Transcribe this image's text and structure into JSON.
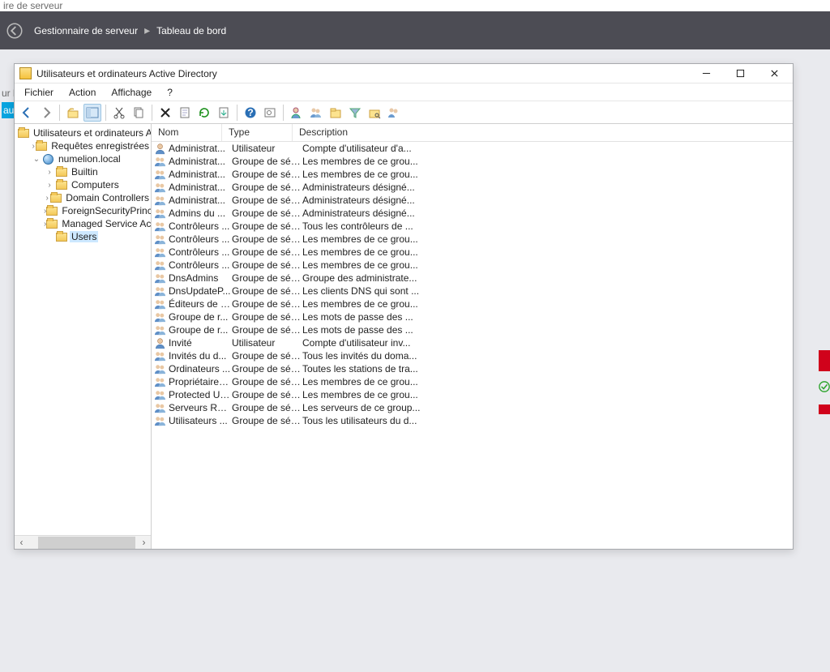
{
  "background": {
    "titlebar_fragment": "ire de serveur",
    "header_title": "Gestionnaire de serveur",
    "header_page": "Tableau de bord",
    "left_txt": "ur l",
    "blue_txt": "au c"
  },
  "window": {
    "title": "Utilisateurs et ordinateurs Active Directory",
    "menu": [
      "Fichier",
      "Action",
      "Affichage",
      "?"
    ]
  },
  "tree": [
    {
      "depth": 0,
      "exp": "",
      "icon": "folder",
      "label": "Utilisateurs et ordinateurs Active"
    },
    {
      "depth": 1,
      "exp": "›",
      "icon": "folder",
      "label": "Requêtes enregistrées"
    },
    {
      "depth": 1,
      "exp": "⌄",
      "icon": "globe",
      "label": "numelion.local"
    },
    {
      "depth": 2,
      "exp": "›",
      "icon": "folder",
      "label": "Builtin"
    },
    {
      "depth": 2,
      "exp": "›",
      "icon": "folder",
      "label": "Computers"
    },
    {
      "depth": 2,
      "exp": "›",
      "icon": "folder",
      "label": "Domain Controllers"
    },
    {
      "depth": 2,
      "exp": "›",
      "icon": "folder",
      "label": "ForeignSecurityPrincipals"
    },
    {
      "depth": 2,
      "exp": "›",
      "icon": "folder",
      "label": "Managed Service Account"
    },
    {
      "depth": 2,
      "exp": "",
      "icon": "folder",
      "label": "Users",
      "sel": true
    }
  ],
  "columns": {
    "name": "Nom",
    "type": "Type",
    "desc": "Description"
  },
  "rows": [
    {
      "icon": "user",
      "name": "Administrat...",
      "type": "Utilisateur",
      "desc": "Compte d'utilisateur d'a..."
    },
    {
      "icon": "group",
      "name": "Administrat...",
      "type": "Groupe de séc...",
      "desc": "Les membres de ce grou..."
    },
    {
      "icon": "group",
      "name": "Administrat...",
      "type": "Groupe de séc...",
      "desc": "Les membres de ce grou..."
    },
    {
      "icon": "group",
      "name": "Administrat...",
      "type": "Groupe de séc...",
      "desc": "Administrateurs désigné..."
    },
    {
      "icon": "group",
      "name": "Administrat...",
      "type": "Groupe de séc...",
      "desc": "Administrateurs désigné..."
    },
    {
      "icon": "group",
      "name": "Admins du ...",
      "type": "Groupe de séc...",
      "desc": "Administrateurs désigné..."
    },
    {
      "icon": "group",
      "name": "Contrôleurs ...",
      "type": "Groupe de séc...",
      "desc": "Tous les contrôleurs de ..."
    },
    {
      "icon": "group",
      "name": "Contrôleurs ...",
      "type": "Groupe de séc...",
      "desc": "Les membres de ce grou..."
    },
    {
      "icon": "group",
      "name": "Contrôleurs ...",
      "type": "Groupe de séc...",
      "desc": "Les membres de ce grou..."
    },
    {
      "icon": "group",
      "name": "Contrôleurs ...",
      "type": "Groupe de séc...",
      "desc": "Les membres de ce grou..."
    },
    {
      "icon": "group",
      "name": "DnsAdmins",
      "type": "Groupe de séc...",
      "desc": "Groupe des administrate..."
    },
    {
      "icon": "group",
      "name": "DnsUpdateP...",
      "type": "Groupe de séc...",
      "desc": "Les clients DNS qui sont ..."
    },
    {
      "icon": "group",
      "name": "Éditeurs de c...",
      "type": "Groupe de séc...",
      "desc": "Les membres de ce grou..."
    },
    {
      "icon": "group",
      "name": "Groupe de r...",
      "type": "Groupe de séc...",
      "desc": "Les mots de passe des ..."
    },
    {
      "icon": "group",
      "name": "Groupe de r...",
      "type": "Groupe de séc...",
      "desc": "Les mots de passe des ..."
    },
    {
      "icon": "user",
      "name": "Invité",
      "type": "Utilisateur",
      "desc": "Compte d'utilisateur inv..."
    },
    {
      "icon": "group",
      "name": "Invités du d...",
      "type": "Groupe de séc...",
      "desc": "Tous les invités du doma..."
    },
    {
      "icon": "group",
      "name": "Ordinateurs ...",
      "type": "Groupe de séc...",
      "desc": "Toutes les stations de tra..."
    },
    {
      "icon": "group",
      "name": "Propriétaires...",
      "type": "Groupe de séc...",
      "desc": "Les membres de ce grou..."
    },
    {
      "icon": "group",
      "name": "Protected Us...",
      "type": "Groupe de séc...",
      "desc": "Les membres de ce grou..."
    },
    {
      "icon": "group",
      "name": "Serveurs RA...",
      "type": "Groupe de séc...",
      "desc": "Les serveurs de ce group..."
    },
    {
      "icon": "group",
      "name": "Utilisateurs ...",
      "type": "Groupe de séc...",
      "desc": "Tous les utilisateurs du d..."
    }
  ]
}
